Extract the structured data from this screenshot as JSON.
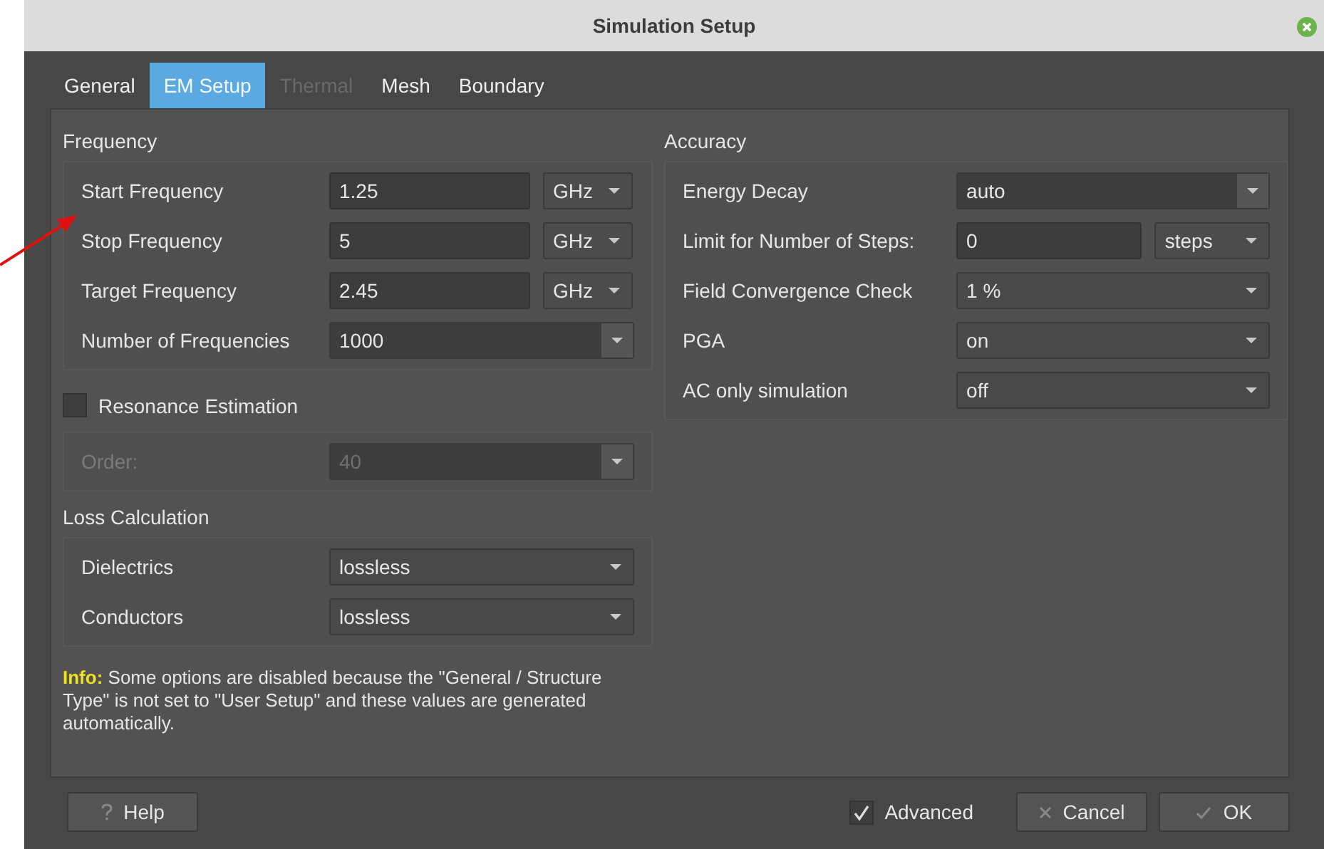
{
  "window": {
    "title": "Simulation Setup"
  },
  "tabs": [
    {
      "label": "General",
      "selected": false,
      "disabled": false
    },
    {
      "label": "EM Setup",
      "selected": true,
      "disabled": false
    },
    {
      "label": "Thermal",
      "selected": false,
      "disabled": true
    },
    {
      "label": "Mesh",
      "selected": false,
      "disabled": false
    },
    {
      "label": "Boundary",
      "selected": false,
      "disabled": false
    }
  ],
  "frequency": {
    "title": "Frequency",
    "rows": [
      {
        "kind": "value_unit",
        "label": "Start Frequency",
        "value": "1.25",
        "unit": "GHz"
      },
      {
        "kind": "value_unit",
        "label": "Stop Frequency",
        "value": "5",
        "unit": "GHz"
      },
      {
        "kind": "value_unit",
        "label": "Target Frequency",
        "value": "2.45",
        "unit": "GHz"
      },
      {
        "kind": "combo",
        "label": "Number of Frequencies",
        "value": "1000"
      }
    ]
  },
  "resonance": {
    "label": "Resonance Estimation",
    "checked": false,
    "order": {
      "label": "Order:",
      "value": "40",
      "disabled": true
    }
  },
  "loss": {
    "title": "Loss Calculation",
    "rows": [
      {
        "kind": "combo",
        "label": "Dielectrics",
        "value": "lossless"
      },
      {
        "kind": "combo",
        "label": "Conductors",
        "value": "lossless"
      }
    ]
  },
  "info": "**Info:** Some options are disabled because the \"General / Structure Type\" is not set to \"User Setup\" and these values are generated automatically.",
  "accuracy": {
    "title": "Accuracy",
    "rows": [
      {
        "kind": "combo",
        "label": "Energy Decay",
        "value": "auto"
      },
      {
        "kind": "value_unit",
        "label": "Limit for Number of Steps:",
        "value": "0",
        "unit": "steps"
      },
      {
        "kind": "combo",
        "label": "Field Convergence Check",
        "value": "1 %"
      },
      {
        "kind": "combo",
        "label": "PGA",
        "value": "on"
      },
      {
        "kind": "combo",
        "label": "AC only simulation",
        "value": "off"
      }
    ]
  },
  "footer": {
    "help": "Help",
    "advanced": {
      "label": "Advanced",
      "checked": true
    },
    "cancel": "Cancel",
    "ok": "OK"
  }
}
